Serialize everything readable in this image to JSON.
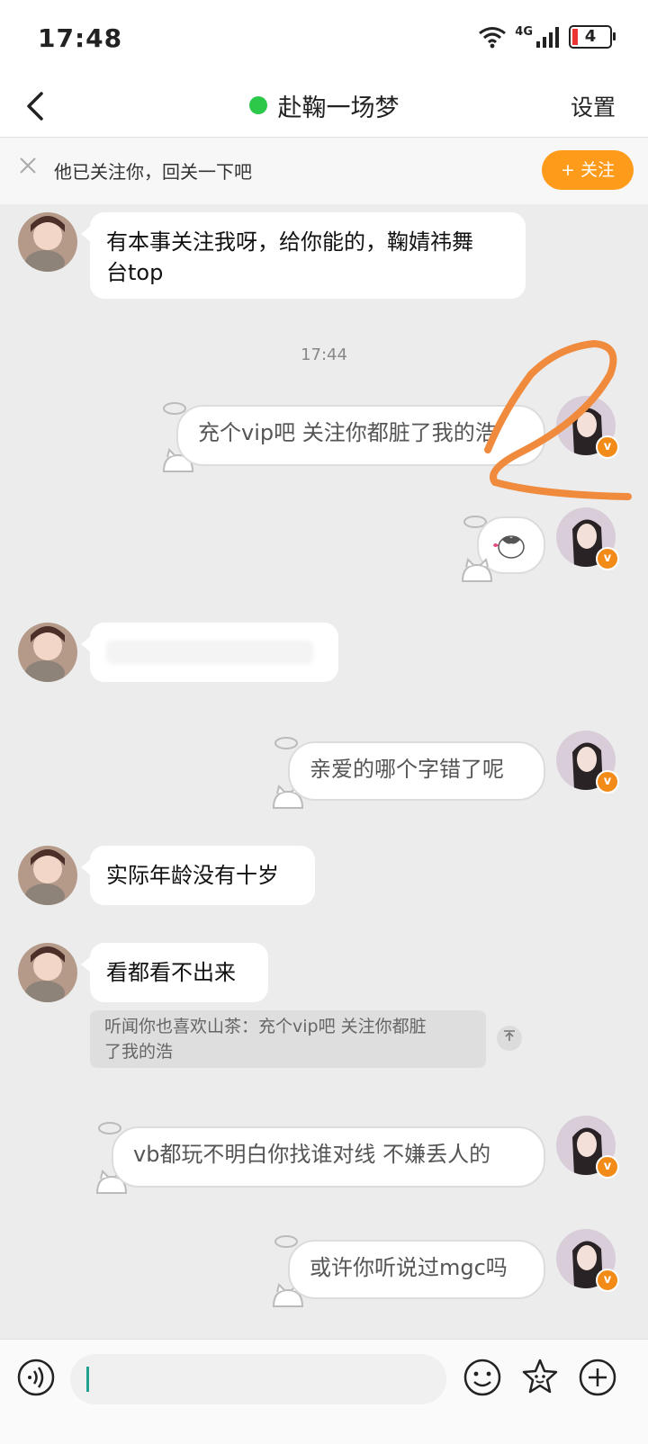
{
  "status_bar": {
    "time": "17:48",
    "network": "4G",
    "battery": "4"
  },
  "nav": {
    "title": "赴鞠一场梦",
    "settings_label": "设置"
  },
  "follow_bar": {
    "text": "他已关注你，回关一下吧",
    "button_label": "+ 关注"
  },
  "messages": [
    {
      "side": "in",
      "text_line1": "有本事关注我呀，给你能的，鞠婧祎舞",
      "text_line2": "台top"
    },
    {
      "type": "timestamp",
      "text": "17:44"
    },
    {
      "side": "out",
      "text": "充个vip吧 关注你都脏了我的浩"
    },
    {
      "side": "out",
      "type": "sticker"
    },
    {
      "side": "in",
      "type": "blurred"
    },
    {
      "side": "out",
      "text": "亲爱的哪个字错了呢"
    },
    {
      "side": "in",
      "text": "实际年龄没有十岁"
    },
    {
      "side": "in",
      "text": "看都看不出来"
    },
    {
      "side": "out",
      "text": "vb都玩不明白你找谁对线 不嫌丢人的"
    },
    {
      "side": "out",
      "text": "或许你听说过mgc吗"
    }
  ],
  "quote": {
    "line1": "听闻你也喜欢山茶：充个vip吧 关注你都脏",
    "line2": "了我的浩"
  },
  "colors": {
    "accent": "#ff9b1a",
    "online": "#2bc84a",
    "badge": "#f28b18",
    "annotation": "#f08a3c"
  }
}
